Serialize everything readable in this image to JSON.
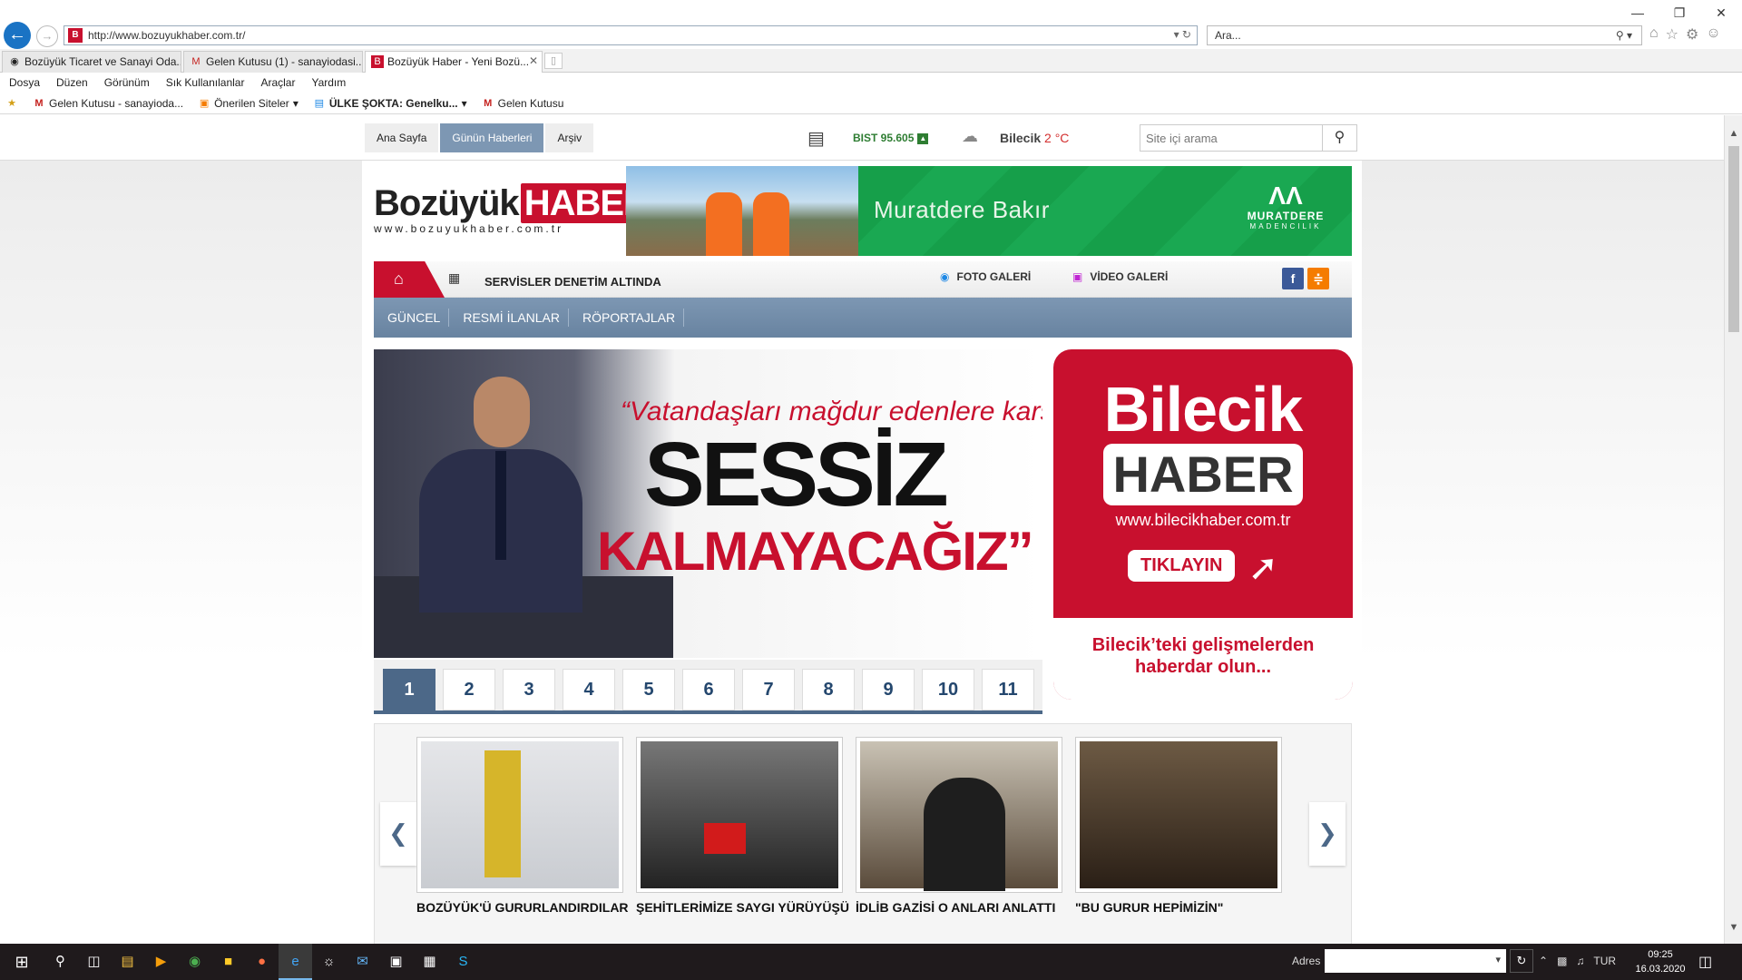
{
  "browser": {
    "url": "http://www.bozuyukhaber.com.tr/",
    "search_placeholder": "Ara...",
    "tabs": [
      {
        "label": "Bozüyük Ticaret ve Sanayi Oda...",
        "active": false
      },
      {
        "label": "Gelen Kutusu (1) - sanayiodasi...",
        "active": false
      },
      {
        "label": "Bozüyük Haber - Yeni Bozü...",
        "active": true
      }
    ],
    "menu": [
      "Dosya",
      "Düzen",
      "Görünüm",
      "Sık Kullanılanlar",
      "Araçlar",
      "Yardım"
    ],
    "favorites": [
      "Gelen Kutusu - sanayioda...",
      "Önerilen Siteler",
      "ÜLKE ŞOKTA: Genelku...",
      "Gelen Kutusu"
    ]
  },
  "site": {
    "topnav": [
      "Ana Sayfa",
      "Günün Haberleri",
      "Arşiv"
    ],
    "bist": "BIST 95.605",
    "weather_city": "Bilecik",
    "weather_temp": "2 °C",
    "search_placeholder": "Site içi arama",
    "logo_text": "Bozüyük",
    "logo_accent": "HABER",
    "logo_url": "www.bozuyukhaber.com.tr",
    "banner": {
      "text": "Muratdere Bakır",
      "brand": "MURATDERE",
      "brand_sub": "MADENCILIK"
    },
    "ticker": "SERVİSLER DENETİM ALTINDA",
    "photo_gallery": "FOTO GALERİ",
    "video_gallery": "VİDEO GALERİ",
    "categories": [
      "GÜNCEL",
      "RESMİ İLANLAR",
      "RÖPORTAJLAR"
    ],
    "slider": {
      "quote": "“Vatandaşları mağdur edenlere karşı",
      "headline_1": "SESSİZ",
      "headline_2": "KALMAYACAĞIZ”",
      "pages": [
        "1",
        "2",
        "3",
        "4",
        "5",
        "6",
        "7",
        "8",
        "9",
        "10",
        "11"
      ],
      "active_page": "1"
    },
    "side_ad": {
      "line1": "Bilecik",
      "line2": "HABER",
      "url": "www.bilecikhaber.com.tr",
      "cta": "TIKLAYIN",
      "footer": "Bilecik’teki gelişmelerden haberdar olun..."
    },
    "carousel": [
      {
        "title": "BOZÜYÜK'Ü GURURLANDIRDILAR"
      },
      {
        "title": "ŞEHİTLERİMİZE SAYGI YÜRÜYÜŞÜ"
      },
      {
        "title": "İDLİB GAZİSİ O ANLARI ANLATTI"
      },
      {
        "title": "\"BU GURUR HEPİMİZİN\""
      }
    ]
  },
  "taskbar": {
    "address_label": "Adres",
    "lang": "TUR",
    "time": "09:25",
    "date": "16.03.2020"
  },
  "colors": {
    "brand_red": "#c8102e",
    "nav_blue": "#7d97b3",
    "banner_green": "#169f4a"
  }
}
